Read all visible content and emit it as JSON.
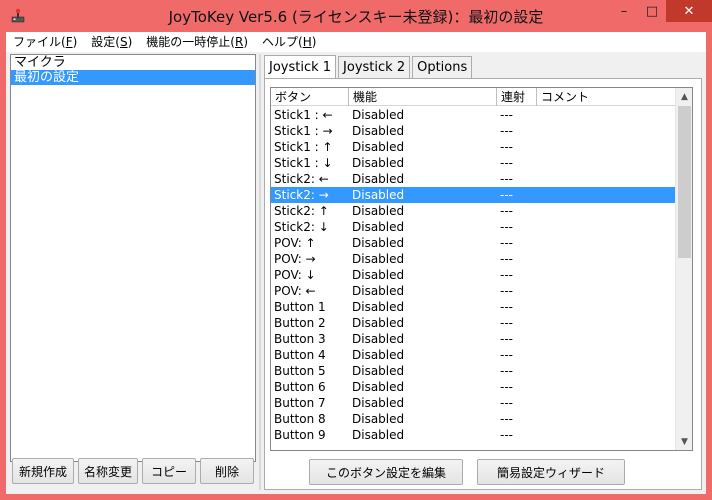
{
  "window": {
    "title": "JoyToKey Ver5.6 (ライセンスキー未登録)：最初の設定",
    "icon": "joystick-icon",
    "colors": {
      "frame": "#f06a6a",
      "selection": "#3399ff"
    }
  },
  "caption": {
    "minimize": "–",
    "maximize": "□",
    "close": "✕"
  },
  "menu": [
    {
      "label": "ファイル(",
      "key": "F",
      "tail": ")"
    },
    {
      "label": "設定(",
      "key": "S",
      "tail": ")"
    },
    {
      "label": "機能の一時停止(",
      "key": "R",
      "tail": ")"
    },
    {
      "label": "ヘルプ(",
      "key": "H",
      "tail": ")"
    }
  ],
  "profiles": [
    {
      "name": "マイクラ",
      "selected": false
    },
    {
      "name": "最初の設定",
      "selected": true
    }
  ],
  "left_buttons": [
    "新規作成",
    "名称変更",
    "コピー",
    "削除"
  ],
  "tabs": [
    {
      "label": "Joystick 1",
      "active": true
    },
    {
      "label": "Joystick 2",
      "active": false
    },
    {
      "label": "Options",
      "active": false
    }
  ],
  "list": {
    "columns": [
      "ボタン",
      "機能",
      "連射",
      "コメント"
    ],
    "rows": [
      {
        "button": "Stick1 : ←",
        "function": "Disabled",
        "rapid": "---",
        "comment": ""
      },
      {
        "button": "Stick1 : →",
        "function": "Disabled",
        "rapid": "---",
        "comment": ""
      },
      {
        "button": "Stick1 : ↑",
        "function": "Disabled",
        "rapid": "---",
        "comment": ""
      },
      {
        "button": "Stick1 : ↓",
        "function": "Disabled",
        "rapid": "---",
        "comment": ""
      },
      {
        "button": "Stick2: ←",
        "function": "Disabled",
        "rapid": "---",
        "comment": ""
      },
      {
        "button": "Stick2: →",
        "function": "Disabled",
        "rapid": "---",
        "comment": "",
        "selected": true
      },
      {
        "button": "Stick2: ↑",
        "function": "Disabled",
        "rapid": "---",
        "comment": ""
      },
      {
        "button": "Stick2: ↓",
        "function": "Disabled",
        "rapid": "---",
        "comment": ""
      },
      {
        "button": "POV: ↑",
        "function": "Disabled",
        "rapid": "---",
        "comment": ""
      },
      {
        "button": "POV: →",
        "function": "Disabled",
        "rapid": "---",
        "comment": ""
      },
      {
        "button": "POV: ↓",
        "function": "Disabled",
        "rapid": "---",
        "comment": ""
      },
      {
        "button": "POV: ←",
        "function": "Disabled",
        "rapid": "---",
        "comment": ""
      },
      {
        "button": "Button 1",
        "function": "Disabled",
        "rapid": "---",
        "comment": ""
      },
      {
        "button": "Button 2",
        "function": "Disabled",
        "rapid": "---",
        "comment": ""
      },
      {
        "button": "Button 3",
        "function": "Disabled",
        "rapid": "---",
        "comment": ""
      },
      {
        "button": "Button 4",
        "function": "Disabled",
        "rapid": "---",
        "comment": ""
      },
      {
        "button": "Button 5",
        "function": "Disabled",
        "rapid": "---",
        "comment": ""
      },
      {
        "button": "Button 6",
        "function": "Disabled",
        "rapid": "---",
        "comment": ""
      },
      {
        "button": "Button 7",
        "function": "Disabled",
        "rapid": "---",
        "comment": ""
      },
      {
        "button": "Button 8",
        "function": "Disabled",
        "rapid": "---",
        "comment": ""
      },
      {
        "button": "Button 9",
        "function": "Disabled",
        "rapid": "---",
        "comment": ""
      }
    ]
  },
  "scrollbar": {
    "up": "▲",
    "down": "▼"
  },
  "bottom_buttons": {
    "edit": "このボタン設定を編集",
    "wizard": "簡易設定ウィザード"
  }
}
